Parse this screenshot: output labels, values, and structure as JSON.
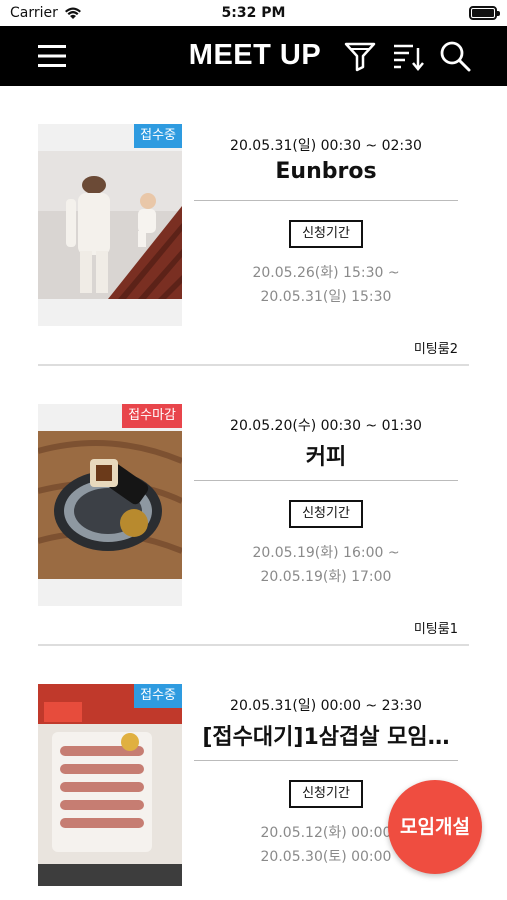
{
  "status_bar": {
    "carrier": "Carrier",
    "time": "5:32 PM"
  },
  "nav": {
    "title": "MEET UP"
  },
  "meetups": [
    {
      "status": "접수중",
      "status_color": "#2e9be0",
      "datetime": "20.05.31(일) 00:30 ~ 02:30",
      "name": "Eunbros",
      "period_label": "신청기간",
      "period_from": "20.05.26(화) 15:30 ~",
      "period_to": "20.05.31(일) 15:30",
      "room": "미팅룸2"
    },
    {
      "status": "접수마감",
      "status_color": "#e8454b",
      "datetime": "20.05.20(수) 00:30 ~ 01:30",
      "name": "커피",
      "period_label": "신청기간",
      "period_from": "20.05.19(화) 16:00 ~",
      "period_to": "20.05.19(화) 17:00",
      "room": "미팅룸1"
    },
    {
      "status": "접수중",
      "status_color": "#2e9be0",
      "datetime": "20.05.31(일) 00:00 ~ 23:30",
      "name": "[접수대기]1삼겹살 모임…",
      "period_label": "신청기간",
      "period_from": "20.05.12(화) 00:00",
      "period_to": "20.05.30(토) 00:00",
      "room": ""
    }
  ],
  "fab": {
    "label": "모임개설",
    "color": "#ef4d40"
  }
}
